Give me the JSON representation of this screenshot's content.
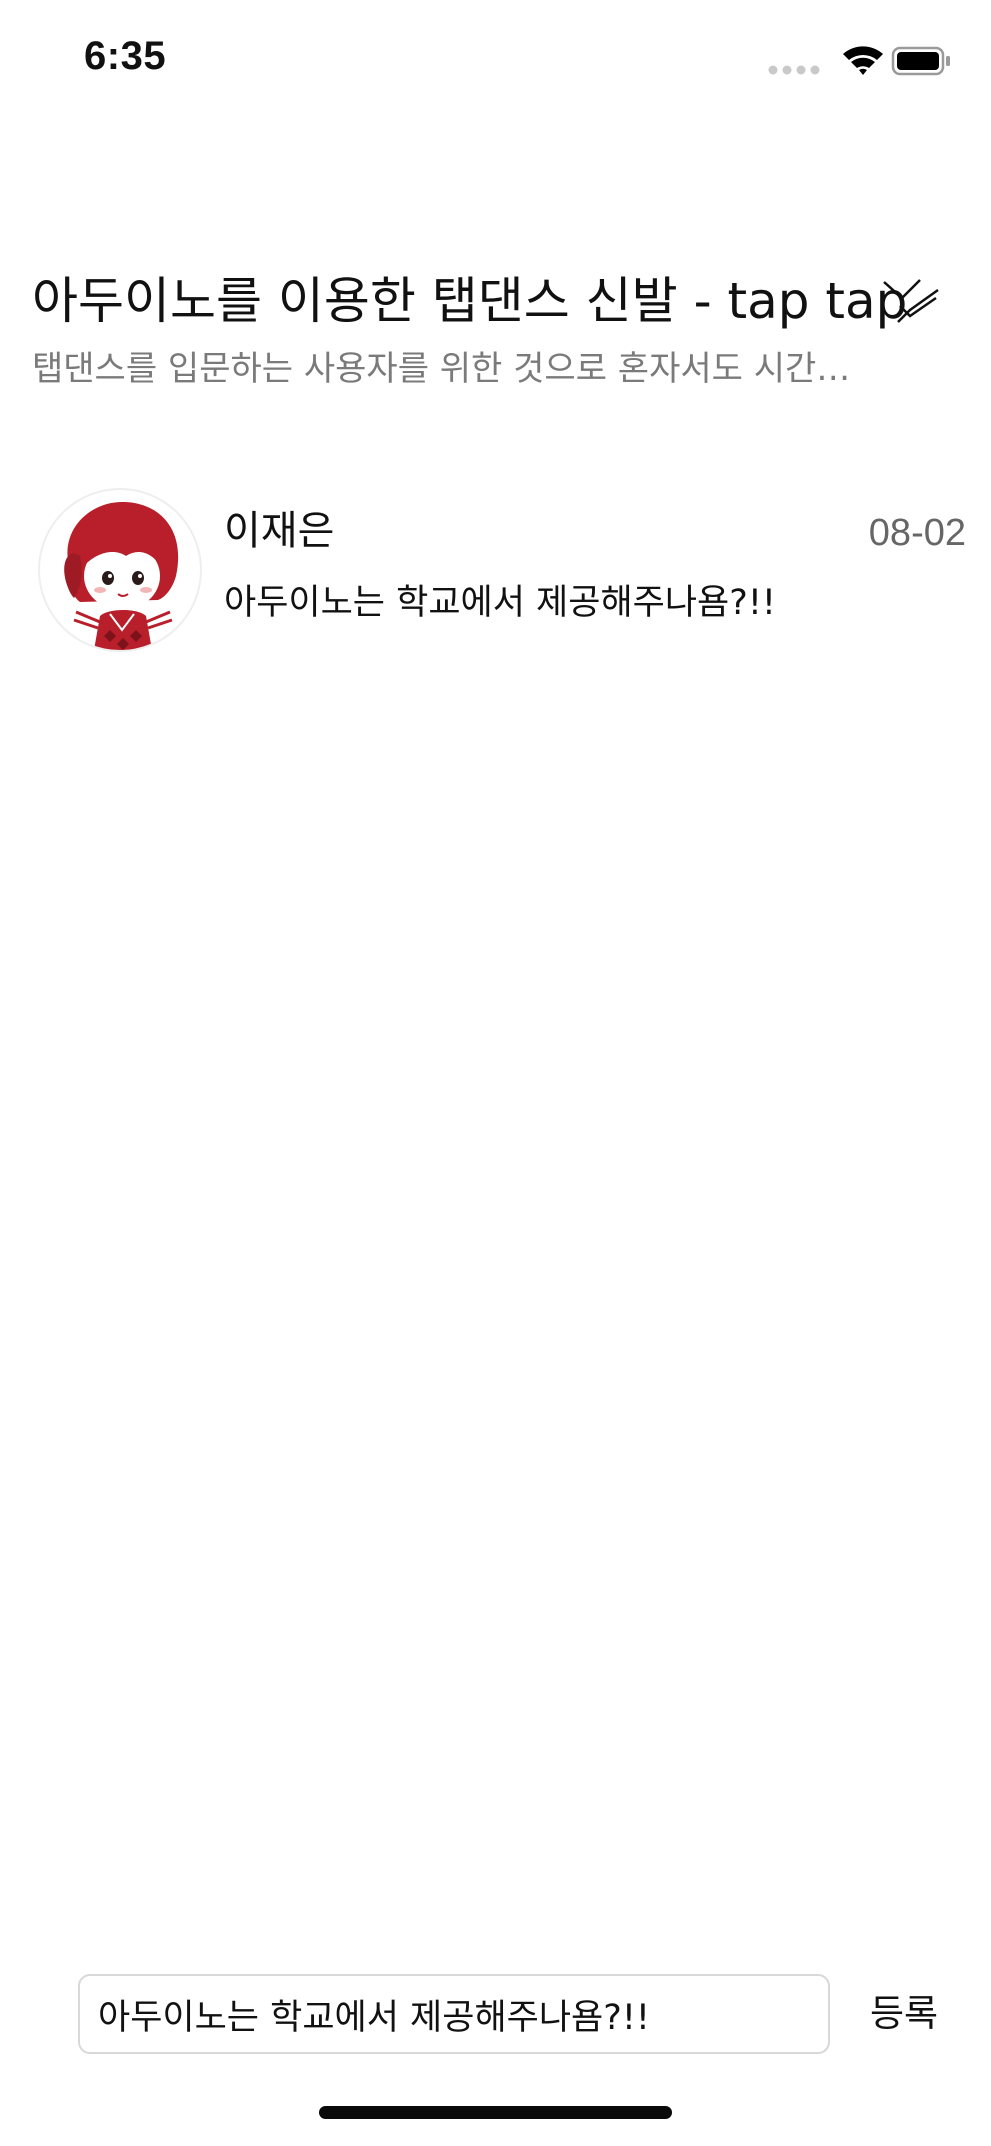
{
  "status_bar": {
    "time": "6:35",
    "icons": [
      "signal-dots-icon",
      "wifi-icon",
      "battery-icon"
    ]
  },
  "post": {
    "title": "아두이노를 이용한 탭댄스 신발 - tap tap",
    "description": "탭댄스를 입문하는 사용자를 위한 것으로 혼자서도 시간…",
    "action_icon": "check-icon"
  },
  "comments": [
    {
      "author": "이재은",
      "date": "08-02",
      "text": "아두이노는 학교에서 제공해주나욤?!!",
      "avatar_icon": "avatar-character-icon"
    }
  ],
  "input_bar": {
    "value": "아두이노는 학교에서 제공해주나욤?!!",
    "submit_label": "등록"
  },
  "colors": {
    "avatar_red": "#b81f2a",
    "muted_text": "#7a7a7a",
    "date_text": "#666666"
  }
}
